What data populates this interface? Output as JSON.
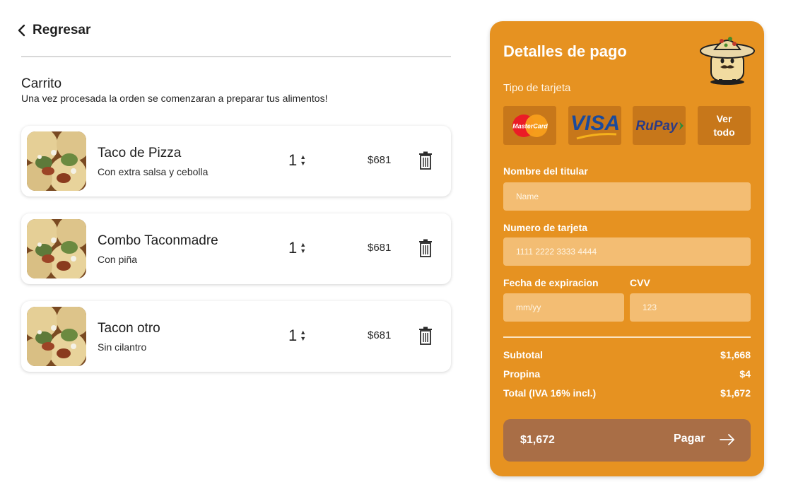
{
  "header": {
    "back_label": "Regresar"
  },
  "cart": {
    "title": "Carrito",
    "subtitle": "Una vez procesada la orden se comenzaran a preparar tus alimentos!",
    "items": [
      {
        "name": "Taco de Pizza",
        "desc": "Con extra salsa y cebolla",
        "qty": "1",
        "price": "$681"
      },
      {
        "name": "Combo Taconmadre",
        "desc": "Con piña",
        "qty": "1",
        "price": "$681"
      },
      {
        "name": "Tacon otro",
        "desc": "Sin cilantro",
        "qty": "1",
        "price": "$681"
      }
    ]
  },
  "payment": {
    "title": "Detalles de pago",
    "card_type_label": "Tipo de tarjeta",
    "cards": {
      "mastercard": "MasterCard",
      "visa": "VISA",
      "rupay": "RuPay",
      "more_line1": "Ver",
      "more_line2": "todo"
    },
    "holder_label": "Nombre del titular",
    "holder_placeholder": "Name",
    "number_label": "Numero de tarjeta",
    "number_placeholder": "1111 2222 3333 4444",
    "expiry_label": "Fecha de expiracion",
    "expiry_placeholder": "mm/yy",
    "cvv_label": "CVV",
    "cvv_placeholder": "123",
    "subtotal_label": "Subtotal",
    "subtotal_value": "$1,668",
    "tip_label": "Propina",
    "tip_value": "$4",
    "total_label": "Total (IVA 16% incl.)",
    "total_value": "$1,672",
    "pay_amount": "$1,672",
    "pay_label": "Pagar"
  },
  "colors": {
    "accent": "#e69221",
    "input_bg": "#f3bd73",
    "card_bg": "#c7771a",
    "pay_button": "#a96e46"
  }
}
